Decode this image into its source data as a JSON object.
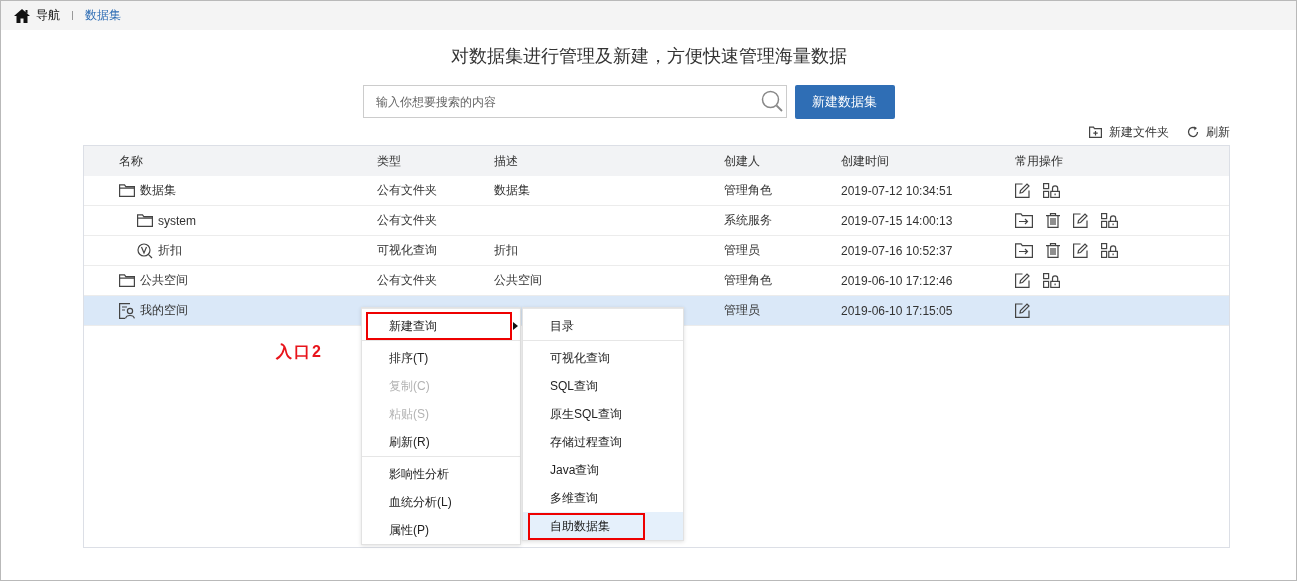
{
  "breadcrumb": {
    "home": "导航",
    "current": "数据集"
  },
  "heading": "对数据集进行管理及新建，方便快速管理海量数据",
  "search": {
    "placeholder": "输入你想要搜索的内容"
  },
  "create_button": "新建数据集",
  "toolbar": [
    {
      "kind": "new_folder",
      "label": "新建文件夹"
    },
    {
      "kind": "refresh",
      "label": "刷新"
    }
  ],
  "table": {
    "columns": [
      "名称",
      "类型",
      "描述",
      "创建人",
      "创建时间",
      "常用操作"
    ],
    "rows": [
      {
        "kind": "folder",
        "name": "数据集",
        "type": "公有文件夹",
        "description": "数据集",
        "creator": "管理角色",
        "created": "2019-07-12 10:34:51",
        "actions": [
          {
            "kind": "edit"
          },
          {
            "kind": "permission"
          }
        ],
        "selected": false,
        "children": [
          {
            "kind": "folder",
            "name": "system",
            "type": "公有文件夹",
            "creator": "系统服务",
            "created": "2019-07-15 14:00:13",
            "actions": [
              {
                "kind": "move"
              },
              {
                "kind": "delete"
              },
              {
                "kind": "edit"
              },
              {
                "kind": "permission"
              }
            ],
            "selected": false
          },
          {
            "kind": "visual_query",
            "name": "折扣",
            "type": "可视化查询",
            "description": "折扣",
            "creator": "管理员",
            "created": "2019-07-16 10:52:37",
            "actions": [
              {
                "kind": "move"
              },
              {
                "kind": "delete"
              },
              {
                "kind": "edit"
              },
              {
                "kind": "permission"
              }
            ],
            "selected": false
          }
        ]
      },
      {
        "kind": "folder",
        "name": "公共空间",
        "type": "公有文件夹",
        "description": "公共空间",
        "creator": "管理角色",
        "created": "2019-06-10 17:12:46",
        "actions": [
          {
            "kind": "edit"
          },
          {
            "kind": "permission"
          }
        ],
        "selected": false
      },
      {
        "kind": "my_space",
        "name": "我的空间",
        "creator": "管理员",
        "created": "2019-06-10 17:15:05",
        "actions": [
          {
            "kind": "edit"
          }
        ],
        "selected": true
      }
    ]
  },
  "context_menu": {
    "groups": [
      [
        {
          "label": "新建查询",
          "disabled": false,
          "has_submenu": true,
          "outlined": true
        }
      ],
      [
        {
          "label": "排序(T)",
          "disabled": false,
          "has_submenu": false,
          "outlined": false
        },
        {
          "label": "复制(C)",
          "disabled": true,
          "has_submenu": false,
          "outlined": false
        },
        {
          "label": "粘贴(S)",
          "disabled": true,
          "has_submenu": false,
          "outlined": false
        },
        {
          "label": "刷新(R)",
          "disabled": false,
          "has_submenu": false,
          "outlined": false
        }
      ],
      [
        {
          "label": "影响性分析",
          "disabled": false,
          "has_submenu": false,
          "outlined": false
        },
        {
          "label": "血统分析(L)",
          "disabled": false,
          "has_submenu": false,
          "outlined": false
        },
        {
          "label": "属性(P)",
          "disabled": false,
          "has_submenu": false,
          "outlined": false
        }
      ]
    ]
  },
  "submenu": {
    "groups": [
      [
        {
          "label": "目录",
          "selected": false,
          "outlined": false
        }
      ],
      [
        {
          "label": "可视化查询",
          "selected": false,
          "outlined": false
        },
        {
          "label": "SQL查询",
          "selected": false,
          "outlined": false
        },
        {
          "label": "原生SQL查询",
          "selected": false,
          "outlined": false
        },
        {
          "label": "存储过程查询",
          "selected": false,
          "outlined": false
        },
        {
          "label": "Java查询",
          "selected": false,
          "outlined": false
        },
        {
          "label": "多维查询",
          "selected": false,
          "outlined": false
        },
        {
          "label": "自助数据集",
          "selected": true,
          "outlined": true
        }
      ]
    ]
  },
  "annotation": "入口2"
}
